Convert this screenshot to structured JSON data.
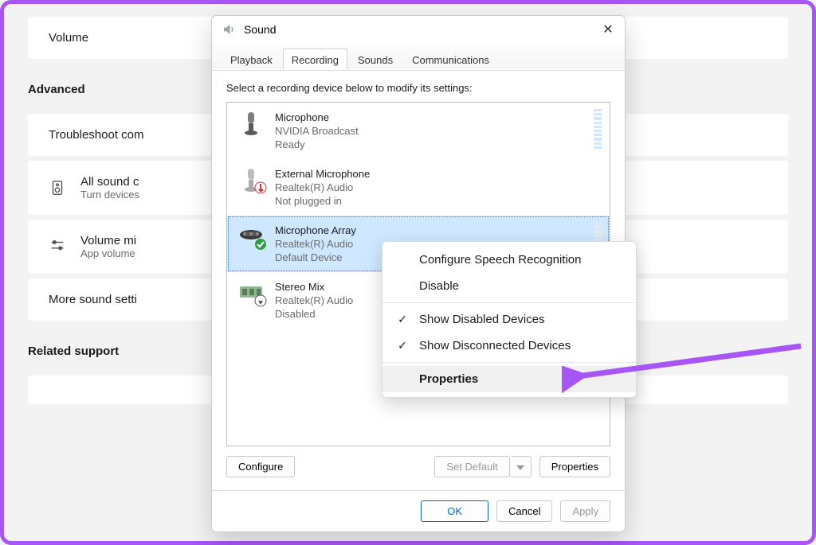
{
  "background": {
    "volume_card": "Volume",
    "advanced_header": "Advanced",
    "troubleshoot": "Troubleshoot com",
    "all_sound_title": "All sound c",
    "all_sound_sub": "Turn devices",
    "volume_mixer_title": "Volume mi",
    "volume_mixer_sub": "App volume",
    "more_settings": "More sound setti",
    "related_header": "Related support"
  },
  "dialog": {
    "title": "Sound",
    "tabs": {
      "playback": "Playback",
      "recording": "Recording",
      "sounds": "Sounds",
      "comms": "Communications"
    },
    "hint": "Select a recording device below to modify its settings:",
    "devices": [
      {
        "name": "Microphone",
        "driver": "NVIDIA Broadcast",
        "status": "Ready"
      },
      {
        "name": "External Microphone",
        "driver": "Realtek(R) Audio",
        "status": "Not plugged in"
      },
      {
        "name": "Microphone Array",
        "driver": "Realtek(R) Audio",
        "status": "Default Device"
      },
      {
        "name": "Stereo Mix",
        "driver": "Realtek(R) Audio",
        "status": "Disabled"
      }
    ],
    "buttons": {
      "configure": "Configure",
      "set_default": "Set Default",
      "properties": "Properties",
      "ok": "OK",
      "cancel": "Cancel",
      "apply": "Apply"
    }
  },
  "context_menu": {
    "configure_speech": "Configure Speech Recognition",
    "disable": "Disable",
    "show_disabled": "Show Disabled Devices",
    "show_disconnected": "Show Disconnected Devices",
    "properties": "Properties"
  }
}
